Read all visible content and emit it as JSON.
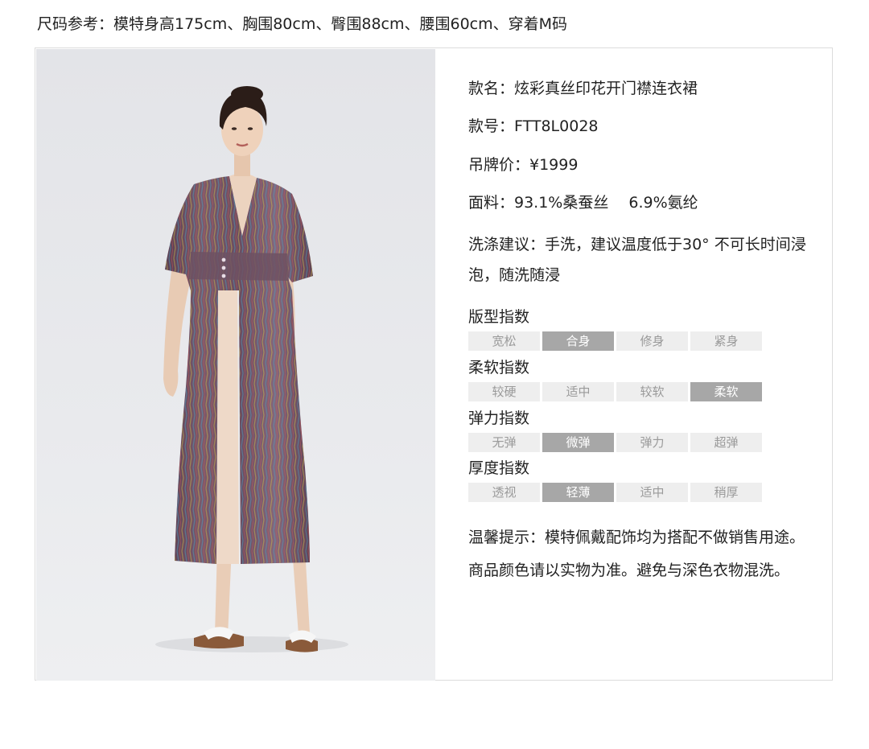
{
  "size_reference": "尺码参考：模特身高175cm、胸围80cm、臀围88cm、腰围60cm、穿着M码",
  "product": {
    "name_line": "款名：炫彩真丝印花开门襟连衣裙",
    "code_line": "款号：FTT8L0028",
    "price_line": "吊牌价：¥1999",
    "fabric_line": "面料：93.1%桑蚕丝　 6.9%氨纶",
    "wash_line": "洗涤建议：手洗，建议温度低于30°  不可长时间浸泡，随洗随浸"
  },
  "indices": [
    {
      "title": "版型指数",
      "options": [
        "宽松",
        "合身",
        "修身",
        "紧身"
      ],
      "selected_index": 1
    },
    {
      "title": "柔软指数",
      "options": [
        "较硬",
        "适中",
        "较软",
        "柔软"
      ],
      "selected_index": 3
    },
    {
      "title": "弹力指数",
      "options": [
        "无弹",
        "微弹",
        "弹力",
        "超弹"
      ],
      "selected_index": 1
    },
    {
      "title": "厚度指数",
      "options": [
        "透视",
        "轻薄",
        "适中",
        "稍厚"
      ],
      "selected_index": 1
    }
  ],
  "tip": "温馨提示：模特佩戴配饰均为搭配不做销售用途。商品颜色请以实物为准。避免与深色衣物混洗。",
  "colors": {
    "selected_segment": "#a7a7a7",
    "unselected_segment": "#eeeeee",
    "unselected_text": "#9a9a9a",
    "dress_base": "#6b4a5a"
  },
  "image": {
    "icon": "model-photo-icon"
  }
}
